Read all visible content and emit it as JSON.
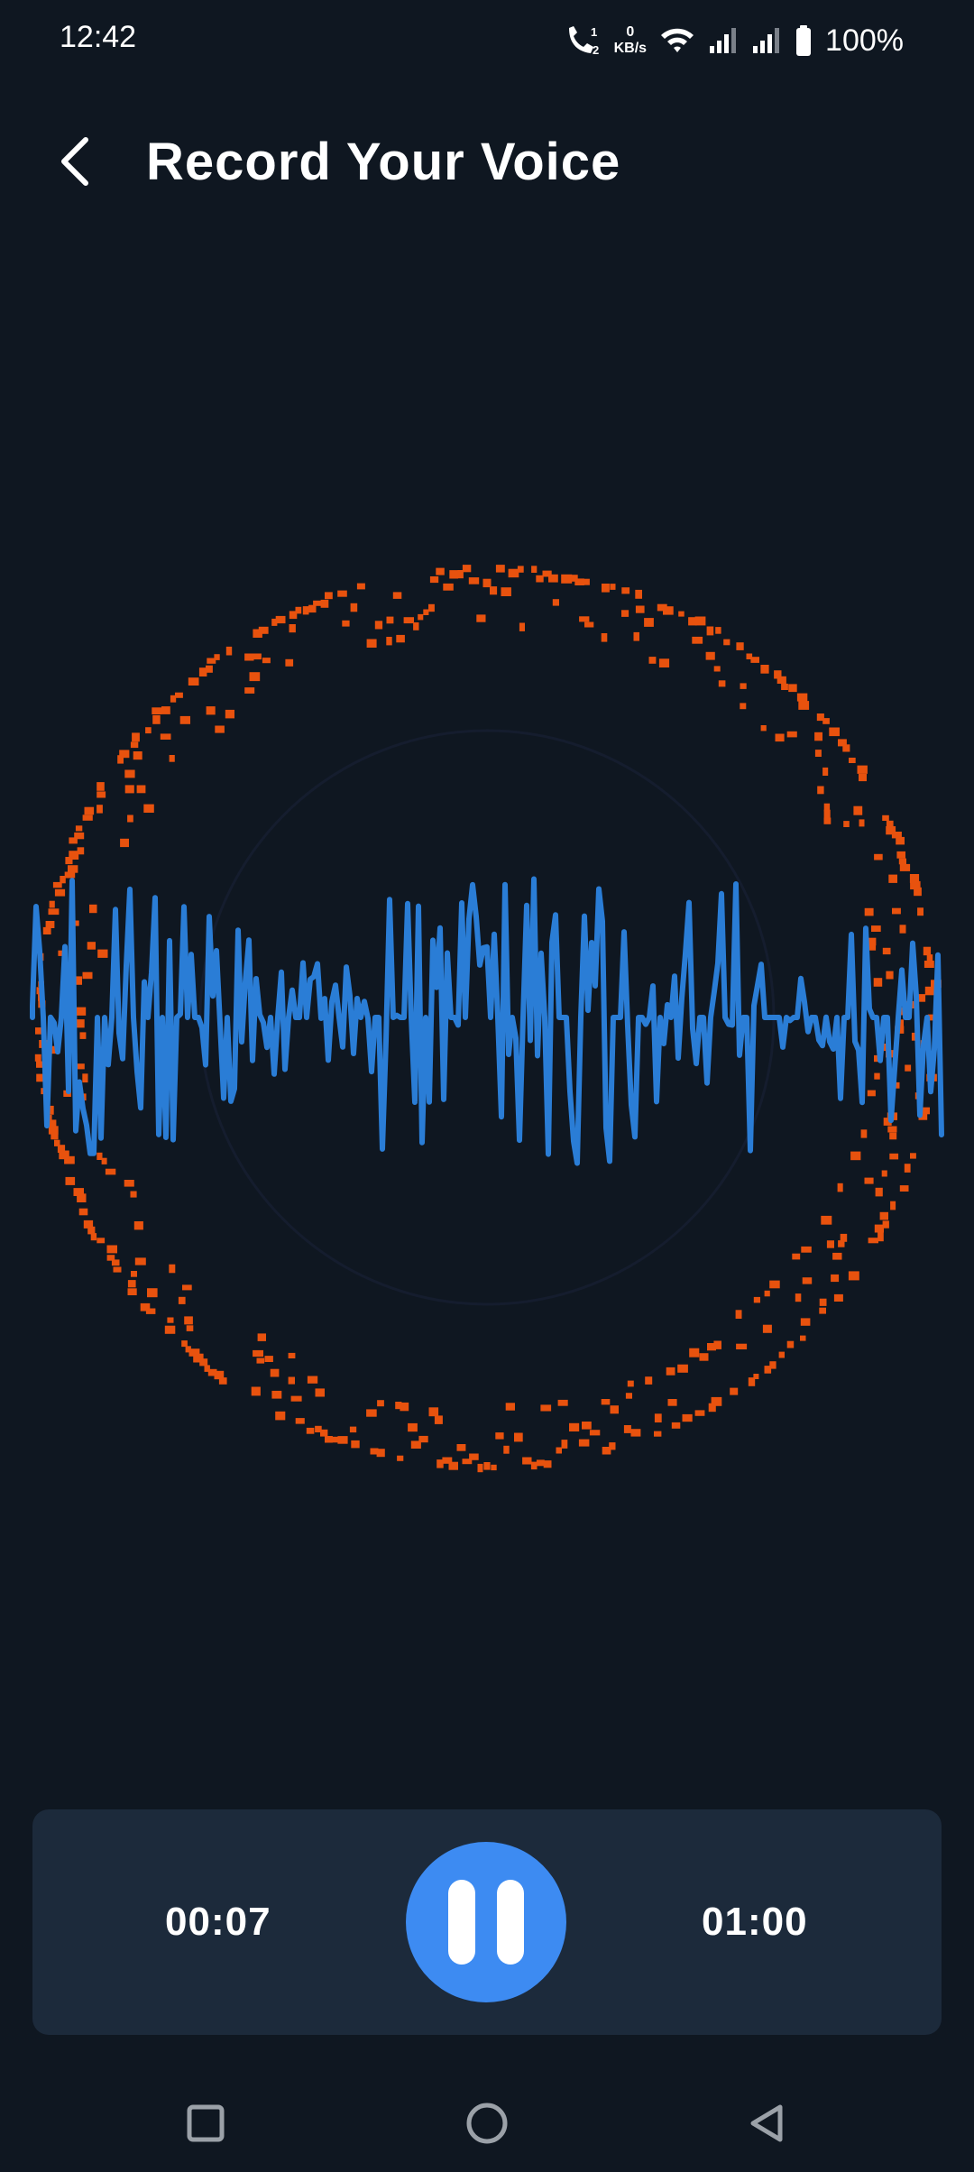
{
  "status_bar": {
    "time": "12:42",
    "net_speed_value": "0",
    "net_speed_unit": "KB/s",
    "battery": "100%",
    "icons": [
      "volte-call-icon",
      "wifi-icon",
      "signal-1-icon",
      "signal-2-icon",
      "battery-icon"
    ]
  },
  "header": {
    "title": "Record Your Voice",
    "back_icon": "chevron-left-icon"
  },
  "visualizer": {
    "wave_color": "#2A7DD6",
    "ring_color": "#E8520E"
  },
  "controls": {
    "elapsed": "00:07",
    "total": "01:00",
    "pause_icon": "pause-icon",
    "button_color": "#3D8BF2"
  },
  "nav_bar": {
    "icons": [
      "recents-square-icon",
      "home-circle-icon",
      "back-triangle-icon"
    ]
  }
}
